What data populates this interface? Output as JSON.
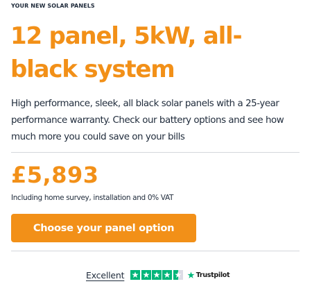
{
  "product": {
    "eyebrow": "YOUR NEW SOLAR PANELS",
    "title": "12 panel, 5kW, all-black system",
    "description": "High performance, sleek, all black solar panels with a 25-year performance warranty. Check our battery options and see how much more you could save on your bills"
  },
  "pricing": {
    "price": "£5,893",
    "note": "Including home survey, installation and 0% VAT"
  },
  "cta": {
    "label": "Choose your panel option"
  },
  "trustpilot": {
    "rating_label": "Excellent",
    "brand": "Trustpilot",
    "star_rating": 4.5,
    "star_color": "#00b67a",
    "empty_star_color": "#dcdce6",
    "icon": "trustpilot-star-icon"
  },
  "colors": {
    "accent": "#f29018",
    "text": "#1e2a3a",
    "divider": "#d4d7dc"
  }
}
